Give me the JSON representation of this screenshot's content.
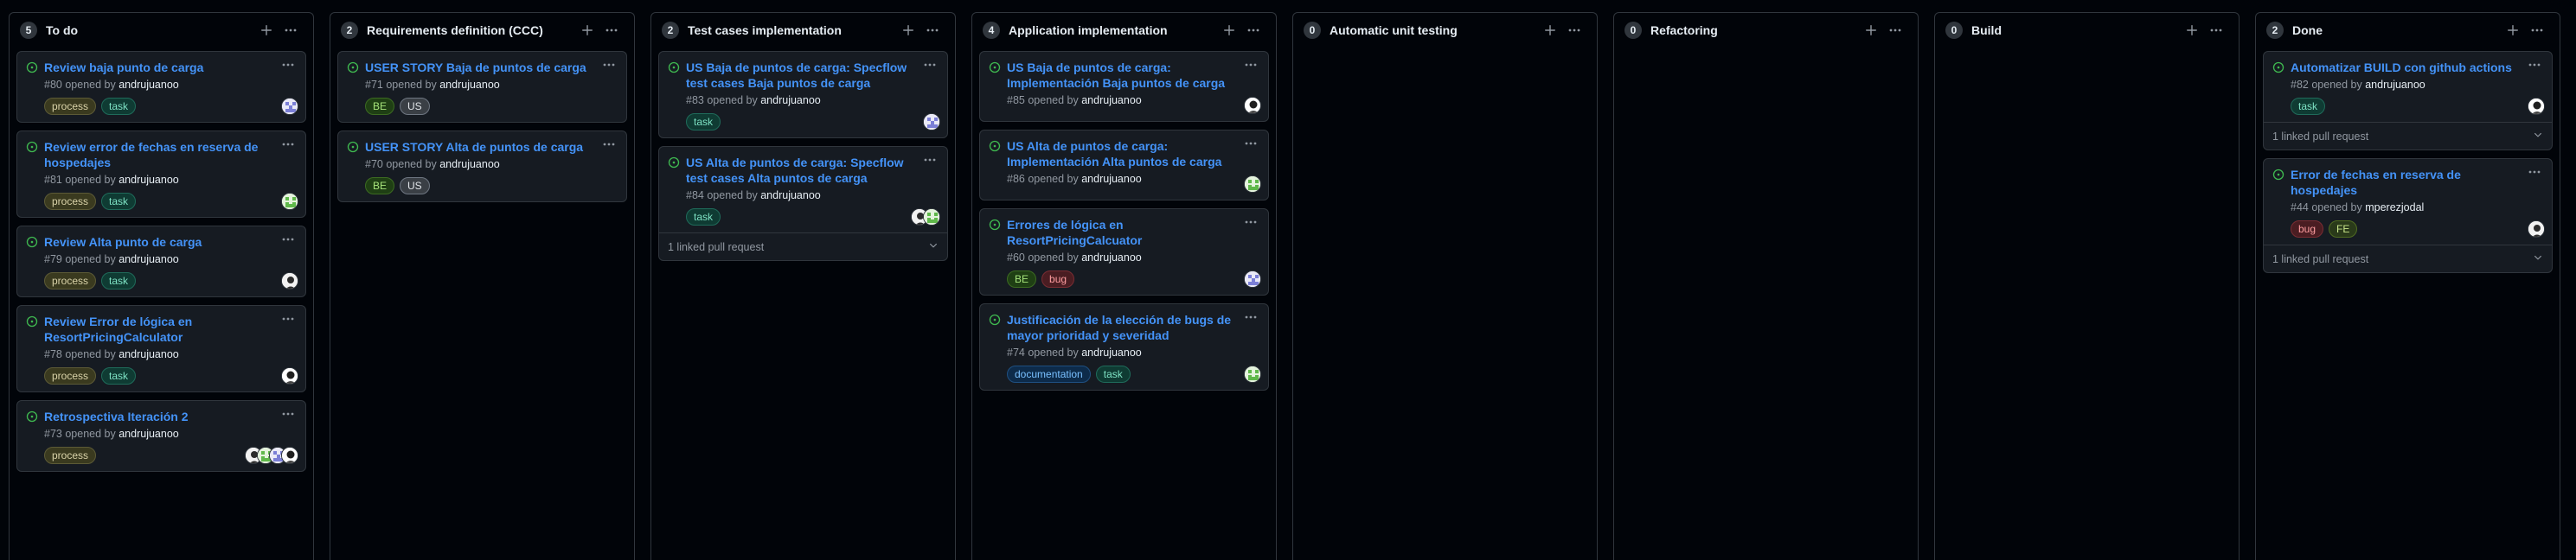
{
  "colors": {
    "link": "#4493f8",
    "open_icon": "#3fb950"
  },
  "labels_style": {
    "process": {
      "bg": "#3a3a1f",
      "fg": "#d9d2a8",
      "border": "#5c5a36"
    },
    "task": {
      "bg": "#0f3b33",
      "fg": "#7ee2c4",
      "border": "#1f6b5a"
    },
    "BE": {
      "bg": "#1f3f14",
      "fg": "#a6e37b",
      "border": "#3c6b21"
    },
    "US": {
      "bg": "#3a3f45",
      "fg": "#e0e4e8",
      "border": "#6e7681"
    },
    "bug": {
      "bg": "#4a1d22",
      "fg": "#ff9da0",
      "border": "#7a2d33"
    },
    "documentation": {
      "bg": "#0d2b4a",
      "fg": "#79c0ff",
      "border": "#1f4f80"
    },
    "FE": {
      "bg": "#2a3a1a",
      "fg": "#c8e58b",
      "border": "#4f6b21"
    }
  },
  "columns": [
    {
      "count": "5",
      "title": "To do",
      "cards": [
        {
          "title": "Review baja punto de carga",
          "number": "#80",
          "opened_by": "opened by",
          "author": "andrujuanoo",
          "labels": [
            "process",
            "task"
          ],
          "avatars": [
            "a1"
          ],
          "linked": null
        },
        {
          "title": "Review error de fechas en reserva de hospedajes",
          "number": "#81",
          "opened_by": "opened by",
          "author": "andrujuanoo",
          "labels": [
            "process",
            "task"
          ],
          "avatars": [
            "a2"
          ],
          "linked": null
        },
        {
          "title": "Review Alta punto de carga",
          "number": "#79",
          "opened_by": "opened by",
          "author": "andrujuanoo",
          "labels": [
            "process",
            "task"
          ],
          "avatars": [
            "a3"
          ],
          "linked": null
        },
        {
          "title": "Review Error de lógica en ResortPricingCalculator",
          "number": "#78",
          "opened_by": "opened by",
          "author": "andrujuanoo",
          "labels": [
            "process",
            "task"
          ],
          "avatars": [
            "a4"
          ],
          "linked": null
        },
        {
          "title": "Retrospectiva Iteración 2",
          "number": "#73",
          "opened_by": "opened by",
          "author": "andrujuanoo",
          "labels": [
            "process"
          ],
          "avatars": [
            "a3",
            "a2",
            "a1",
            "a4"
          ],
          "linked": null
        }
      ]
    },
    {
      "count": "2",
      "title": "Requirements definition (CCC)",
      "cards": [
        {
          "title": "USER STORY Baja de puntos de carga",
          "number": "#71",
          "opened_by": "opened by",
          "author": "andrujuanoo",
          "labels": [
            "BE",
            "US"
          ],
          "avatars": [],
          "linked": null
        },
        {
          "title": "USER STORY Alta de puntos de carga",
          "number": "#70",
          "opened_by": "opened by",
          "author": "andrujuanoo",
          "labels": [
            "BE",
            "US"
          ],
          "avatars": [],
          "linked": null
        }
      ]
    },
    {
      "count": "2",
      "title": "Test cases implementation",
      "cards": [
        {
          "title": "US Baja de puntos de carga: Specflow test cases Baja puntos de carga",
          "number": "#83",
          "opened_by": "opened by",
          "author": "andrujuanoo",
          "labels": [
            "task"
          ],
          "avatars": [
            "a1"
          ],
          "linked": null
        },
        {
          "title": "US Alta de puntos de carga: Specflow test cases Alta puntos de carga",
          "number": "#84",
          "opened_by": "opened by",
          "author": "andrujuanoo",
          "labels": [
            "task"
          ],
          "avatars": [
            "a3",
            "a2"
          ],
          "linked": "1 linked pull request"
        }
      ]
    },
    {
      "count": "4",
      "title": "Application implementation",
      "cards": [
        {
          "title": "US Baja de puntos de carga: Implementación Baja puntos de carga",
          "number": "#85",
          "opened_by": "opened by",
          "author": "andrujuanoo",
          "labels": [],
          "avatars": [
            "a4"
          ],
          "linked": null
        },
        {
          "title": "US Alta de puntos de carga: Implementación Alta puntos de carga",
          "number": "#86",
          "opened_by": "opened by",
          "author": "andrujuanoo",
          "labels": [],
          "avatars": [
            "a2"
          ],
          "linked": null
        },
        {
          "title": "Errores de lógica en ResortPricingCalcuator",
          "number": "#60",
          "opened_by": "opened by",
          "author": "andrujuanoo",
          "labels": [
            "BE",
            "bug"
          ],
          "avatars": [
            "a1"
          ],
          "linked": null
        },
        {
          "title": "Justificación de la elección de bugs de mayor prioridad y severidad",
          "number": "#74",
          "opened_by": "opened by",
          "author": "andrujuanoo",
          "labels": [
            "documentation",
            "task"
          ],
          "avatars": [
            "a2"
          ],
          "linked": null
        }
      ]
    },
    {
      "count": "0",
      "title": "Automatic unit testing",
      "cards": []
    },
    {
      "count": "0",
      "title": "Refactoring",
      "cards": []
    },
    {
      "count": "0",
      "title": "Build",
      "cards": []
    },
    {
      "count": "2",
      "title": "Done",
      "cards": [
        {
          "title": "Automatizar BUILD con github actions",
          "number": "#82",
          "opened_by": "opened by",
          "author": "andrujuanoo",
          "labels": [
            "task"
          ],
          "avatars": [
            "a4"
          ],
          "linked": "1 linked pull request"
        },
        {
          "title": "Error de fechas en reserva de hospedajes",
          "number": "#44",
          "opened_by": "opened by",
          "author": "mperezjodal",
          "labels": [
            "bug",
            "FE"
          ],
          "avatars": [
            "a3"
          ],
          "linked": "1 linked pull request"
        }
      ]
    }
  ]
}
